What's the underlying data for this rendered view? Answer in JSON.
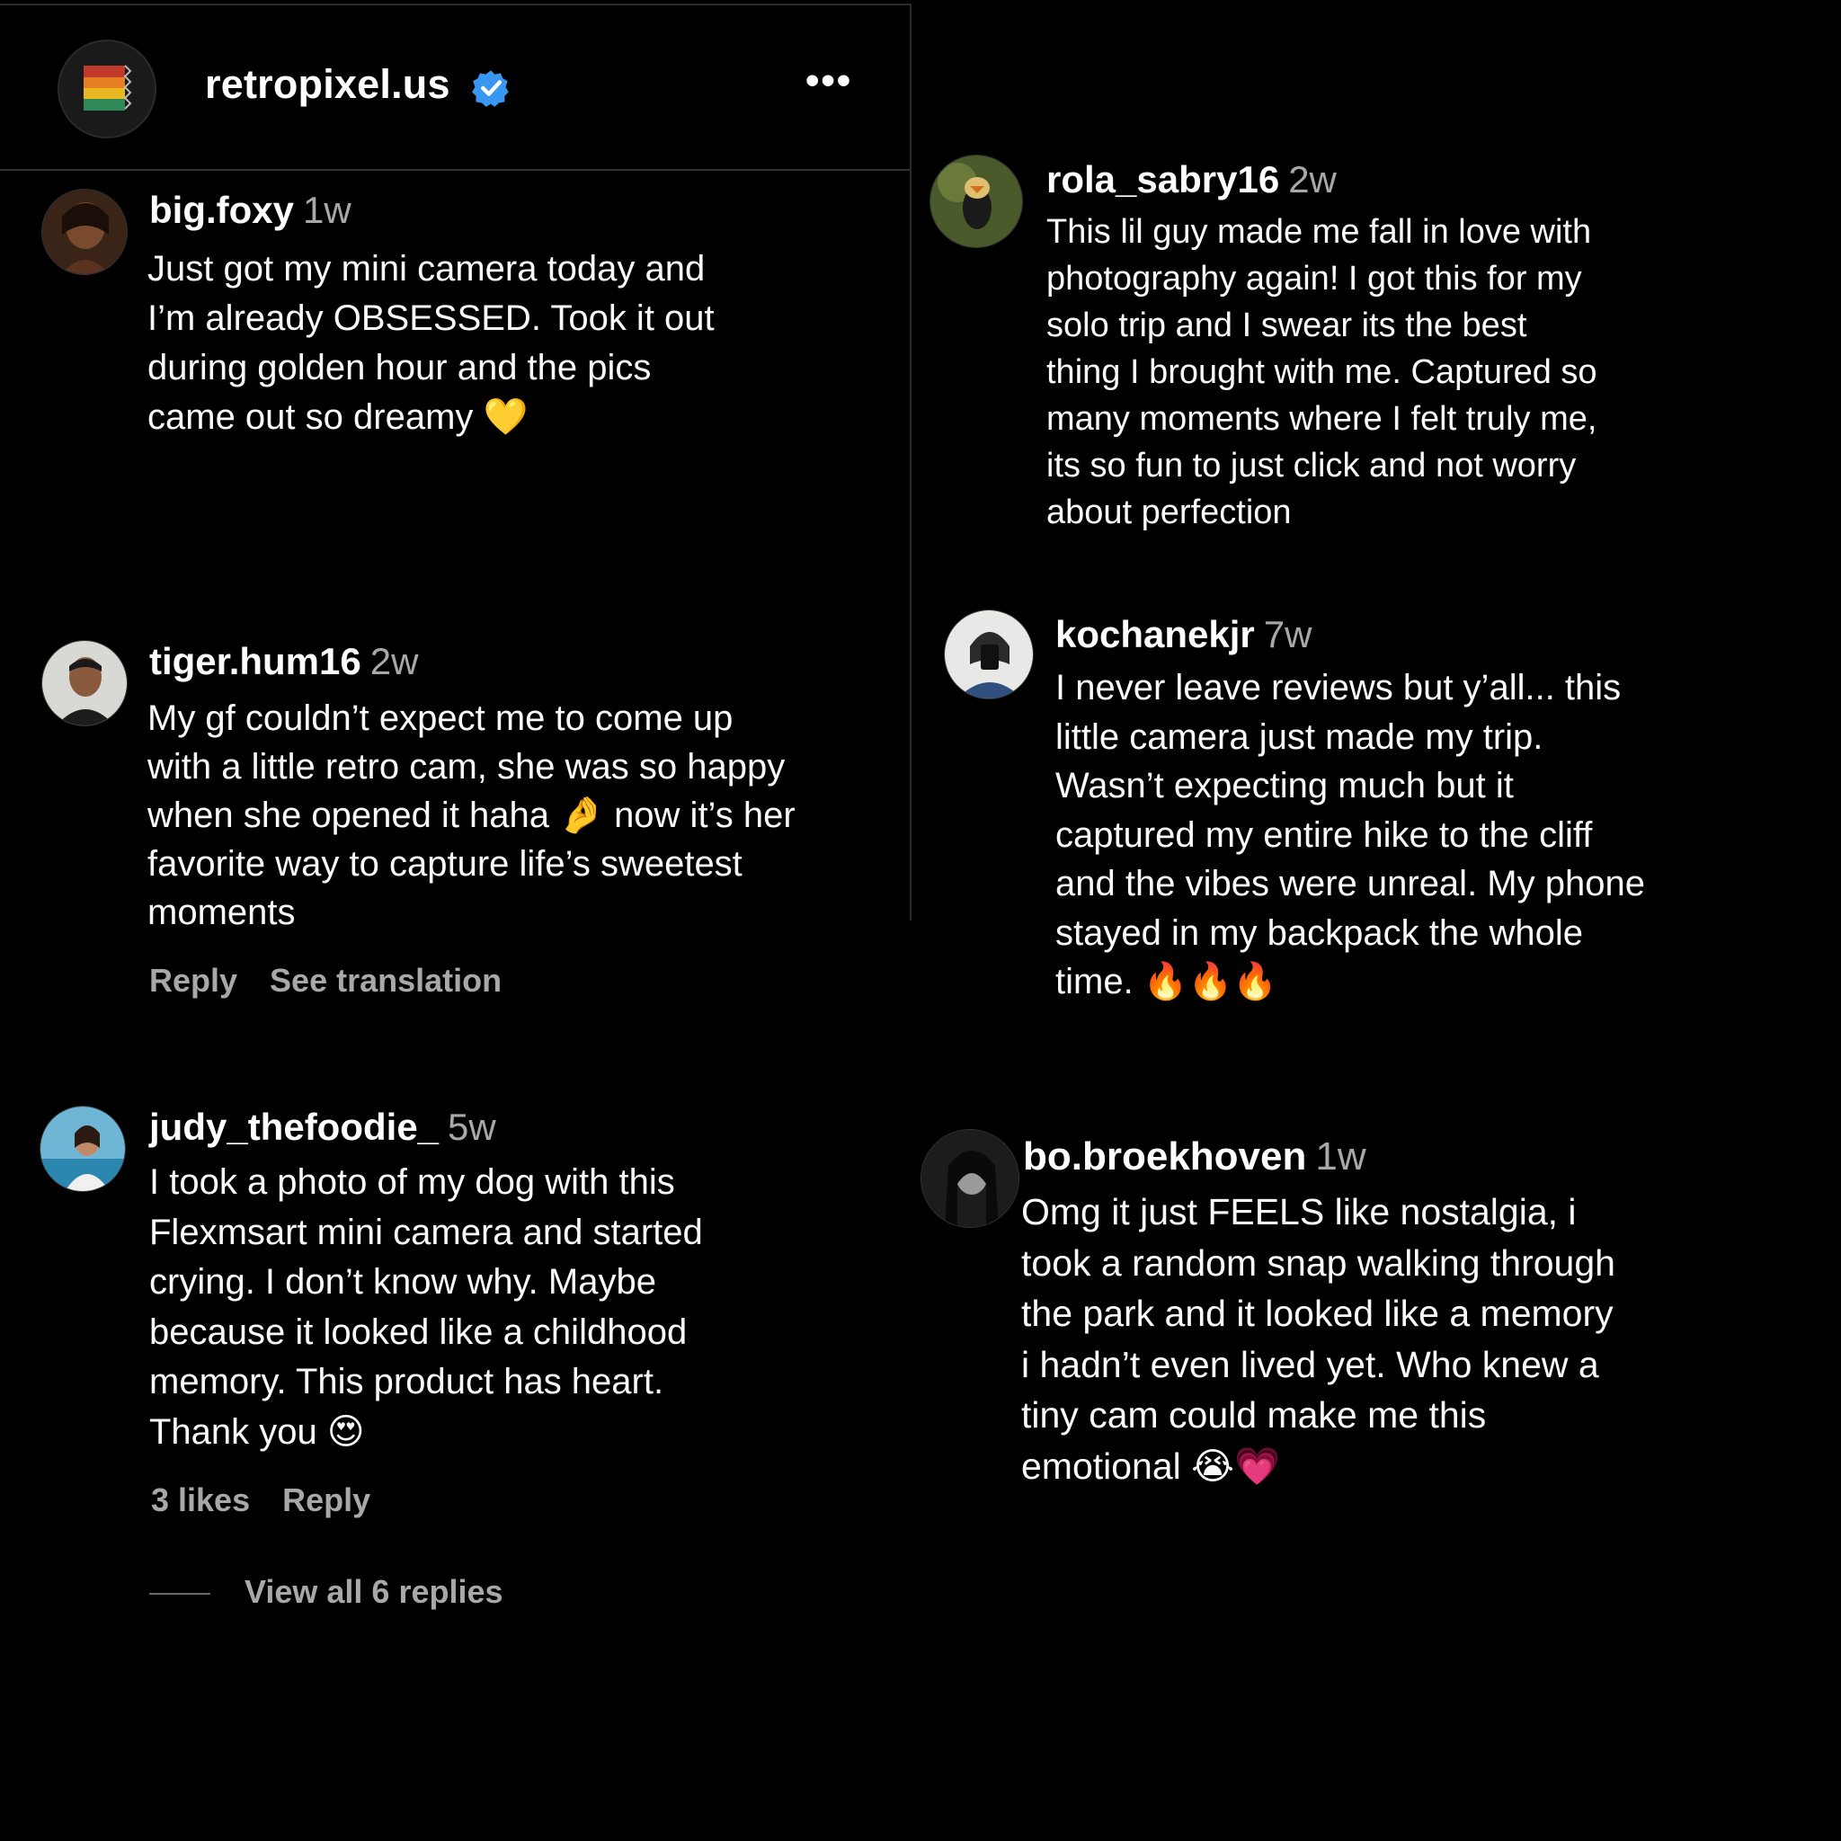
{
  "header": {
    "account_name": "retropixel.us",
    "more_label": "•••"
  },
  "colors": {
    "background": "#000000",
    "verified_blue": "#3897f0",
    "muted_text": "#a8a8a8"
  },
  "comments": [
    {
      "username": "big.foxy",
      "time": "1w",
      "text": "Just got my mini camera today and\nI’m already OBSESSED. Took it out\nduring golden hour and the pics\ncame out so dreamy 💛"
    },
    {
      "username": "tiger.hum16",
      "time": "2w",
      "text": "My gf couldn’t expect me to come up\nwith a little retro cam, she was so happy\nwhen she opened it haha 🤌 now it’s her\nfavorite way to capture life’s sweetest\nmoments",
      "reply_label": "Reply",
      "translation_label": "See translation"
    },
    {
      "username": "judy_thefoodie_",
      "time": "5w",
      "text": "I took a photo of my dog with this\nFlexmsart mini camera and started\ncrying. I don’t know why. Maybe\nbecause it looked like a childhood\nmemory. This product has heart.\nThank you 😍",
      "likes_label": "3 likes",
      "reply_label": "Reply",
      "view_replies_label": "View all 6 replies"
    },
    {
      "username": "rola_sabry16",
      "time": "2w",
      "text": "This lil guy made me fall in love with\nphotography again! I got this for my\nsolo trip and I swear its the best\nthing I brought with me. Captured so\nmany moments where I felt truly me,\nits so fun to just click and not worry\nabout perfection"
    },
    {
      "username": "kochanekjr",
      "time": "7w",
      "text": "I never leave reviews but y’all... this\nlittle camera just made my trip.\nWasn’t expecting much but it\ncaptured my entire hike to the cliff\nand the vibes were unreal. My phone\nstayed in my backpack the whole\ntime. 🔥🔥🔥"
    },
    {
      "username": "bo.broekhoven",
      "time": "1w",
      "text": "Omg it just FEELS like nostalgia, i\ntook a random snap walking through\nthe park and it looked like a memory\ni hadn’t even lived yet. Who knew a\ntiny cam could make me this\nemotional 😭💗"
    }
  ]
}
